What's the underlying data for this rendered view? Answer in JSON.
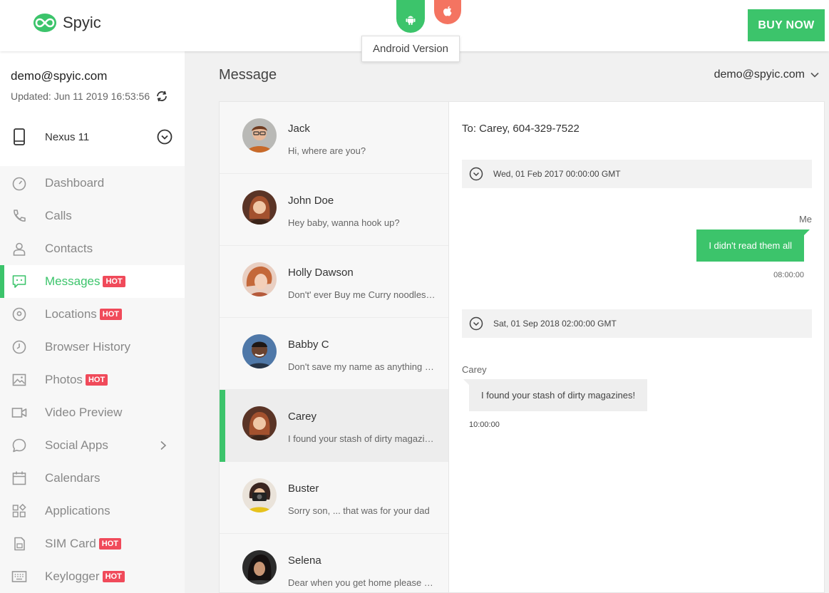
{
  "header": {
    "logo_text": "Spyic",
    "android_tooltip": "Android Version",
    "buy_label": "BUY NOW"
  },
  "colors": {
    "accent": "#3cc46b",
    "apple": "#f47461",
    "hot": "#f04a5a"
  },
  "sidebar": {
    "email": "demo@spyic.com",
    "updated": "Updated: Jun 11 2019 16:53:56",
    "device": "Nexus 11",
    "hot_label": "HOT",
    "items": [
      {
        "label": "Dashboard",
        "icon": "dashboard-icon",
        "hot": false
      },
      {
        "label": "Calls",
        "icon": "phone-icon",
        "hot": false
      },
      {
        "label": "Contacts",
        "icon": "person-icon",
        "hot": false
      },
      {
        "label": "Messages",
        "icon": "message-icon",
        "hot": true,
        "active": true
      },
      {
        "label": "Locations",
        "icon": "location-icon",
        "hot": true
      },
      {
        "label": "Browser History",
        "icon": "clock-icon",
        "hot": false
      },
      {
        "label": "Photos",
        "icon": "image-icon",
        "hot": true
      },
      {
        "label": "Video Preview",
        "icon": "video-icon",
        "hot": false
      },
      {
        "label": "Social Apps",
        "icon": "chat-bubble-icon",
        "hot": false,
        "submenu": true
      },
      {
        "label": "Calendars",
        "icon": "calendar-icon",
        "hot": false
      },
      {
        "label": "Applications",
        "icon": "apps-icon",
        "hot": false
      },
      {
        "label": "SIM Card",
        "icon": "sim-card-icon",
        "hot": true
      },
      {
        "label": "Keylogger",
        "icon": "keyboard-icon",
        "hot": true
      }
    ]
  },
  "main": {
    "title": "Message",
    "user": "demo@spyic.com"
  },
  "conversations": [
    {
      "name": "Jack",
      "preview": "Hi, where are you?"
    },
    {
      "name": "John Doe",
      "preview": "Hey baby, wanna hook up?"
    },
    {
      "name": "Holly Dawson",
      "preview": "Don't' ever Buy me Curry noodles again"
    },
    {
      "name": "Babby C",
      "preview": "Don't save my name as anything weird"
    },
    {
      "name": "Carey",
      "preview": "I found your stash of dirty magazines!",
      "active": true
    },
    {
      "name": "Buster",
      "preview": "Sorry son, ... that was for your dad"
    },
    {
      "name": "Selena",
      "preview": "Dear when you get home please call"
    }
  ],
  "thread": {
    "to": "To: Carey, 604-329-7522",
    "date1": "Wed, 01 Feb 2017 00:00:00 GMT",
    "sender_me": "Me",
    "msg_out": "I didn't read them all",
    "time_out": "08:00:00",
    "date2": "Sat, 01 Sep 2018 02:00:00 GMT",
    "sender_in": "Carey",
    "msg_in": "I found your stash of dirty magazines!",
    "time_in": "10:00:00"
  }
}
